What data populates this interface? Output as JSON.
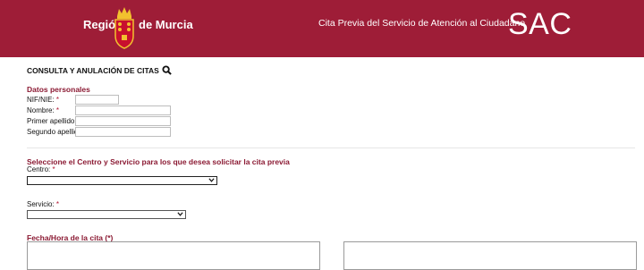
{
  "header": {
    "logo_left": "Región",
    "logo_right": "de Murcia",
    "subtitle": "Cita Previa del Servicio de Atención al Ciudadano",
    "sac": "SAC",
    "brand_color": "#9e1d37"
  },
  "consulta": {
    "label": "CONSULTA Y ANULACIÓN DE CITAS",
    "icon": "search-icon"
  },
  "datos_personales": {
    "title": "Datos personales",
    "fields": [
      {
        "label": "NIF/NIE:",
        "required": "*"
      },
      {
        "label": "Nombre:",
        "required": "*"
      },
      {
        "label": "Primer apellido:",
        "required": "*"
      },
      {
        "label": "Segundo apellido:",
        "required": ""
      }
    ]
  },
  "centro": {
    "section_title": "Seleccione el Centro y Servicio para los que desea solicitar la cita previa",
    "label": "Centro:",
    "required": "*"
  },
  "servicio": {
    "label": "Servicio:",
    "required": "*"
  },
  "fecha": {
    "label": "Fecha/Hora de la cita (*)"
  }
}
